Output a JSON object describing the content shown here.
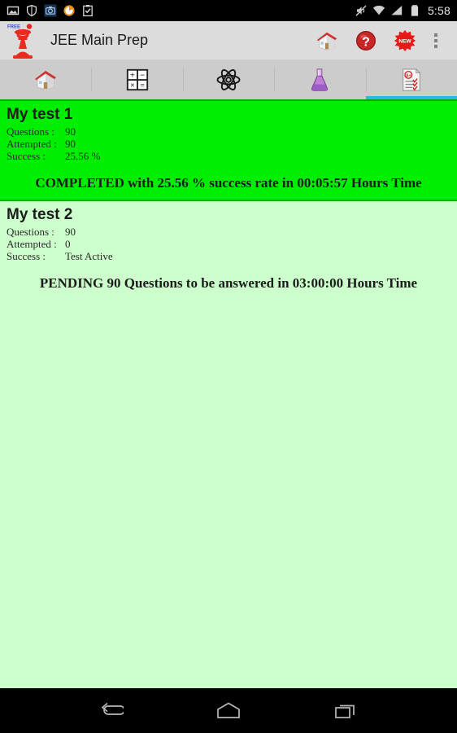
{
  "status_bar": {
    "left_icons": [
      "image-icon",
      "shield-icon",
      "camera-sync-icon",
      "orange-circle-icon",
      "clipboard-check-icon"
    ],
    "right_icons": [
      "mute-icon",
      "wifi-icon",
      "signal-icon",
      "battery-icon"
    ],
    "time": "5:58"
  },
  "action_bar": {
    "logo": "chess-piece-logo",
    "logo_badge": "FREE",
    "title": "JEE Main Prep",
    "actions": [
      {
        "name": "home-action-icon",
        "label": "Home"
      },
      {
        "name": "help-action-icon",
        "label": "Help"
      },
      {
        "name": "new-badge-action-icon",
        "label": "NEW"
      }
    ],
    "overflow_label": "More options"
  },
  "tabs": [
    {
      "name": "tab-home",
      "icon": "house-icon",
      "label": "Home",
      "selected": false
    },
    {
      "name": "tab-maths",
      "icon": "calculator-icon",
      "label": "Maths",
      "selected": false
    },
    {
      "name": "tab-physics",
      "icon": "atom-icon",
      "label": "Physics",
      "selected": false
    },
    {
      "name": "tab-chemistry",
      "icon": "flask-icon",
      "label": "Chemistry",
      "selected": false
    },
    {
      "name": "tab-tests",
      "icon": "test-paper-icon",
      "label": "Tests",
      "selected": true
    }
  ],
  "tests": [
    {
      "title": "My test 1",
      "state": "completed",
      "questions_label": "Questions :",
      "questions_value": "90",
      "attempted_label": "Attempted :",
      "attempted_value": "90",
      "success_label": "Success :",
      "success_value": "25.56 %",
      "status_text": "COMPLETED with 25.56 % success rate in 00:05:57 Hours Time"
    },
    {
      "title": "My test 2",
      "state": "pending",
      "questions_label": "Questions :",
      "questions_value": "90",
      "attempted_label": "Attempted :",
      "attempted_value": "0",
      "success_label": "Success :",
      "success_value": "Test Active",
      "status_text": "PENDING 90 Questions to be answered in 03:00:00 Hours Time"
    }
  ],
  "nav_bar": {
    "back": "back-icon",
    "home": "home-icon",
    "recents": "recents-icon"
  },
  "colors": {
    "accent": "#33b5e5",
    "completed_bg": "#00ee00",
    "completed_border": "#00aa00",
    "page_bg": "#ccffcc",
    "action_bar_bg": "#dcdcdc",
    "tab_bar_bg": "#cccccc"
  }
}
